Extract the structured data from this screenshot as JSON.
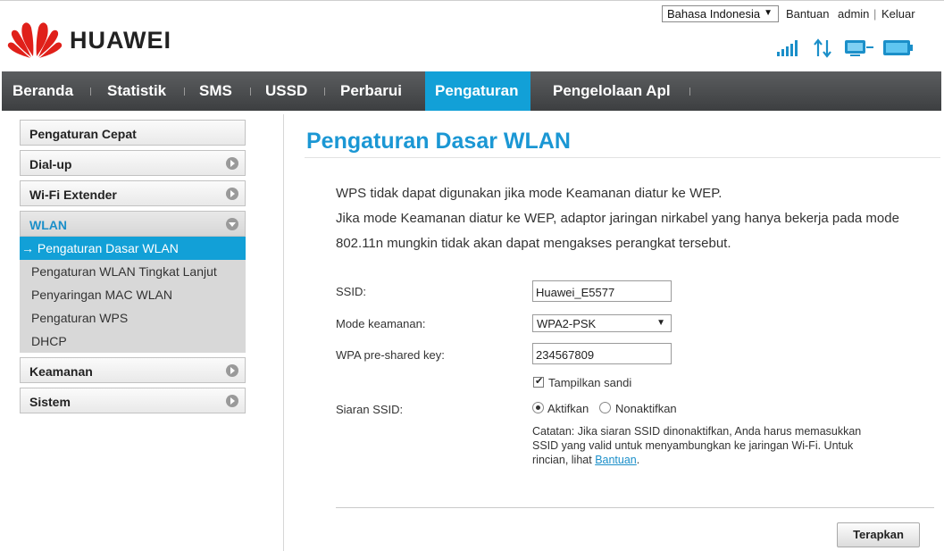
{
  "header": {
    "brand": "HUAWEI",
    "language": "Bahasa Indonesia",
    "links": {
      "help": "Bantuan",
      "user": "admin",
      "logout": "Keluar"
    },
    "status_icons": [
      "signal-strength-icon",
      "data-transfer-icon",
      "pc-connection-icon",
      "battery-icon"
    ]
  },
  "nav": {
    "items": [
      "Beranda",
      "Statistik",
      "SMS",
      "USSD",
      "Perbarui",
      "Pengaturan",
      "Pengelolaan Apl"
    ],
    "active": "Pengaturan"
  },
  "sidebar": {
    "sections": [
      "Pengaturan Cepat",
      "Dial-up",
      "Wi-Fi Extender",
      "WLAN",
      "Keamanan",
      "Sistem"
    ],
    "wlan_items": [
      "Pengaturan Dasar WLAN",
      "Pengaturan WLAN Tingkat Lanjut",
      "Penyaringan MAC WLAN",
      "Pengaturan WPS",
      "DHCP"
    ],
    "active_item_prefix": "→"
  },
  "main": {
    "title": "Pengaturan Dasar WLAN",
    "notice_line1": "WPS tidak dapat digunakan jika mode Keamanan diatur ke WEP.",
    "notice_line2": "Jika mode Keamanan diatur ke WEP, adaptor jaringan nirkabel yang hanya bekerja pada mode",
    "notice_line3": "802.11n mungkin tidak akan dapat mengakses perangkat tersebut.",
    "form": {
      "ssid_label": "SSID:",
      "ssid_value": "Huawei_E5577",
      "security_label": "Mode keamanan:",
      "security_value": "WPA2-PSK",
      "psk_label": "WPA pre-shared key:",
      "psk_value": "234567809",
      "show_password_label": "Tampilkan sandi",
      "broadcast_label": "Siaran SSID:",
      "enable_label": "Aktifkan",
      "disable_label": "Nonaktifkan",
      "note_text": "Catatan: Jika siaran SSID dinonaktifkan, Anda harus memasukkan SSID yang valid untuk menyambungkan ke jaringan Wi-Fi. Untuk rincian, lihat ",
      "note_link": "Bantuan",
      "note_end": "."
    },
    "apply_button": "Terapkan"
  },
  "colors": {
    "accent": "#12a0d7",
    "title": "#1b97d4",
    "brand_red": "#e0201a"
  }
}
